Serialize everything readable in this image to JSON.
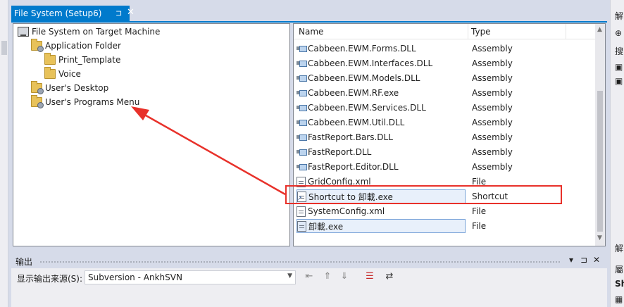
{
  "document_tab": {
    "title": "File System (Setup6)",
    "pin": "⊐",
    "close": "✕"
  },
  "tree": {
    "items": [
      {
        "label": "File System on Target Machine",
        "icon": "computer-icon"
      },
      {
        "label": "Application Folder",
        "icon": "folder-gear-icon"
      },
      {
        "label": "Print_Template",
        "icon": "folder-icon"
      },
      {
        "label": "Voice",
        "icon": "folder-icon"
      },
      {
        "label": "User's Desktop",
        "icon": "folder-gear-icon"
      },
      {
        "label": "User's Programs Menu",
        "icon": "folder-gear-icon"
      }
    ]
  },
  "list": {
    "columns": {
      "name": "Name",
      "type": "Type"
    },
    "rows": [
      {
        "name": "Cabbeen.EWM.Forms.DLL",
        "type": "Assembly",
        "icon": "assembly-icon"
      },
      {
        "name": "Cabbeen.EWM.Interfaces.DLL",
        "type": "Assembly",
        "icon": "assembly-icon"
      },
      {
        "name": "Cabbeen.EWM.Models.DLL",
        "type": "Assembly",
        "icon": "assembly-icon"
      },
      {
        "name": "Cabbeen.EWM.RF.exe",
        "type": "Assembly",
        "icon": "assembly-icon"
      },
      {
        "name": "Cabbeen.EWM.Services.DLL",
        "type": "Assembly",
        "icon": "assembly-icon"
      },
      {
        "name": "Cabbeen.EWM.Util.DLL",
        "type": "Assembly",
        "icon": "assembly-icon"
      },
      {
        "name": "FastReport.Bars.DLL",
        "type": "Assembly",
        "icon": "assembly-icon"
      },
      {
        "name": "FastReport.DLL",
        "type": "Assembly",
        "icon": "assembly-icon"
      },
      {
        "name": "FastReport.Editor.DLL",
        "type": "Assembly",
        "icon": "assembly-icon"
      },
      {
        "name": "GridConfig.xml",
        "type": "File",
        "icon": "file-icon"
      },
      {
        "name": "Shortcut to 卸載.exe",
        "type": "Shortcut",
        "icon": "shortcut-icon"
      },
      {
        "name": "SystemConfig.xml",
        "type": "File",
        "icon": "file-icon"
      },
      {
        "name": "卸載.exe",
        "type": "File",
        "icon": "file-icon"
      }
    ]
  },
  "output": {
    "title": "输出",
    "controls": {
      "dropdown": "▾",
      "pin": "⊐",
      "close": "✕"
    },
    "source_label": "显示输出来源(S):",
    "source_value": "Subversion - AnkhSVN"
  },
  "right_strip": {
    "top_glyph": "解",
    "search_glyph": "搜",
    "bottom_glyph": "解",
    "prop_glyph": "屬",
    "sh": "Sh"
  },
  "annotation_color": "#e8312a",
  "accent_color": "#007acc"
}
